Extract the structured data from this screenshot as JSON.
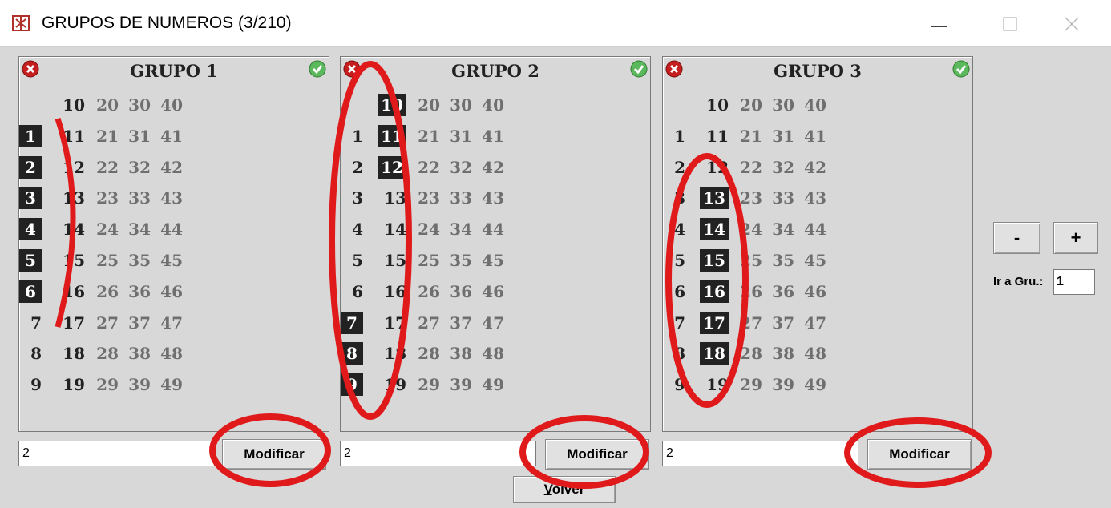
{
  "window": {
    "title": "GRUPOS DE NUMEROS (3/210)"
  },
  "groups": [
    {
      "title": "GRUPO 1",
      "field_value": "2",
      "button_label": "Modificar",
      "rows": [
        [
          "",
          "10",
          "20",
          "30",
          "40"
        ],
        [
          "1",
          "11",
          "21",
          "31",
          "41"
        ],
        [
          "2",
          "12",
          "22",
          "32",
          "42"
        ],
        [
          "3",
          "13",
          "23",
          "33",
          "43"
        ],
        [
          "4",
          "14",
          "24",
          "34",
          "44"
        ],
        [
          "5",
          "15",
          "25",
          "35",
          "45"
        ],
        [
          "6",
          "16",
          "26",
          "36",
          "46"
        ],
        [
          "7",
          "17",
          "27",
          "37",
          "47"
        ],
        [
          "8",
          "18",
          "28",
          "38",
          "48"
        ],
        [
          "9",
          "19",
          "29",
          "39",
          "49"
        ]
      ],
      "selected": [
        "1",
        "2",
        "3",
        "4",
        "5",
        "6"
      ]
    },
    {
      "title": "GRUPO 2",
      "field_value": "2",
      "button_label": "Modificar",
      "rows": [
        [
          "",
          "10",
          "20",
          "30",
          "40"
        ],
        [
          "1",
          "11",
          "21",
          "31",
          "41"
        ],
        [
          "2",
          "12",
          "22",
          "32",
          "42"
        ],
        [
          "3",
          "13",
          "23",
          "33",
          "43"
        ],
        [
          "4",
          "14",
          "24",
          "34",
          "44"
        ],
        [
          "5",
          "15",
          "25",
          "35",
          "45"
        ],
        [
          "6",
          "16",
          "26",
          "36",
          "46"
        ],
        [
          "7",
          "17",
          "27",
          "37",
          "47"
        ],
        [
          "8",
          "18",
          "28",
          "38",
          "48"
        ],
        [
          "9",
          "19",
          "29",
          "39",
          "49"
        ]
      ],
      "selected": [
        "10",
        "11",
        "12",
        "7",
        "8",
        "9"
      ]
    },
    {
      "title": "GRUPO 3",
      "field_value": "2",
      "button_label": "Modificar",
      "rows": [
        [
          "",
          "10",
          "20",
          "30",
          "40"
        ],
        [
          "1",
          "11",
          "21",
          "31",
          "41"
        ],
        [
          "2",
          "12",
          "22",
          "32",
          "42"
        ],
        [
          "3",
          "13",
          "23",
          "33",
          "43"
        ],
        [
          "4",
          "14",
          "24",
          "34",
          "44"
        ],
        [
          "5",
          "15",
          "25",
          "35",
          "45"
        ],
        [
          "6",
          "16",
          "26",
          "36",
          "46"
        ],
        [
          "7",
          "17",
          "27",
          "37",
          "47"
        ],
        [
          "8",
          "18",
          "28",
          "38",
          "48"
        ],
        [
          "9",
          "19",
          "29",
          "39",
          "49"
        ]
      ],
      "selected": [
        "13",
        "14",
        "15",
        "16",
        "17",
        "18"
      ]
    }
  ],
  "nav": {
    "minus_label": "-",
    "plus_label": "+",
    "goto_label": "Ir a Gru.:",
    "goto_value": "1"
  },
  "footer": {
    "volver_label": "Volver",
    "volver_mnemonic": "V"
  },
  "icons": {
    "remove": "red-x-icon",
    "confirm": "green-check-icon",
    "app": "app-logo-icon"
  },
  "colors": {
    "selected_bg": "#222222",
    "dim_text": "#6f6f6f",
    "annotation": "#e0191b"
  }
}
